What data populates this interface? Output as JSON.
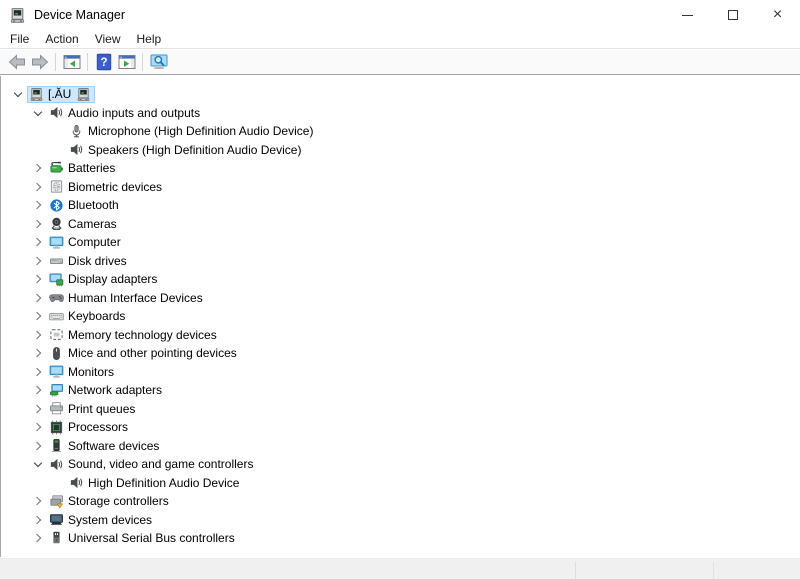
{
  "window": {
    "title": "Device Manager",
    "app_icon": "device-manager-icon",
    "controls": {
      "minimize": "minimize",
      "maximize": "maximize",
      "close_glyph": "×"
    }
  },
  "menubar": {
    "items": [
      {
        "label": "File"
      },
      {
        "label": "Action"
      },
      {
        "label": "View"
      },
      {
        "label": "Help"
      }
    ]
  },
  "toolbar": {
    "items": [
      {
        "type": "button",
        "name": "back",
        "icon": "back-arrow-icon"
      },
      {
        "type": "button",
        "name": "forward",
        "icon": "forward-arrow-icon"
      },
      {
        "type": "separator"
      },
      {
        "type": "button",
        "name": "show-console-tree",
        "icon": "console-tree-icon"
      },
      {
        "type": "separator"
      },
      {
        "type": "button",
        "name": "help",
        "icon": "help-icon"
      },
      {
        "type": "button",
        "name": "show-action-pane",
        "icon": "action-pane-icon"
      },
      {
        "type": "separator"
      },
      {
        "type": "button",
        "name": "scan-hardware-changes",
        "icon": "scan-hardware-icon"
      }
    ]
  },
  "tree": {
    "items": [
      {
        "label": "[.ĂU",
        "icon": "computer-icon",
        "trailing_icon": "computer-icon",
        "level": 0,
        "state": "expanded",
        "selected": true
      },
      {
        "label": "Audio inputs and outputs",
        "icon": "speaker-icon",
        "level": 1,
        "state": "expanded"
      },
      {
        "label": "Microphone (High Definition Audio Device)",
        "icon": "microphone-icon",
        "level": 2,
        "state": "none"
      },
      {
        "label": "Speakers (High Definition Audio Device)",
        "icon": "speaker-icon",
        "level": 2,
        "state": "none"
      },
      {
        "label": "Batteries",
        "icon": "battery-icon",
        "level": 1,
        "state": "collapsed"
      },
      {
        "label": "Biometric devices",
        "icon": "fingerprint-icon",
        "level": 1,
        "state": "collapsed"
      },
      {
        "label": "Bluetooth",
        "icon": "bluetooth-icon",
        "level": 1,
        "state": "collapsed"
      },
      {
        "label": "Cameras",
        "icon": "camera-icon",
        "level": 1,
        "state": "collapsed"
      },
      {
        "label": "Computer",
        "icon": "monitor-icon",
        "level": 1,
        "state": "collapsed"
      },
      {
        "label": "Disk drives",
        "icon": "disk-drive-icon",
        "level": 1,
        "state": "collapsed"
      },
      {
        "label": "Display adapters",
        "icon": "display-adapter-icon",
        "level": 1,
        "state": "collapsed"
      },
      {
        "label": "Human Interface Devices",
        "icon": "gamepad-icon",
        "level": 1,
        "state": "collapsed"
      },
      {
        "label": "Keyboards",
        "icon": "keyboard-icon",
        "level": 1,
        "state": "collapsed"
      },
      {
        "label": "Memory technology devices",
        "icon": "memory-icon",
        "level": 1,
        "state": "collapsed"
      },
      {
        "label": "Mice and other pointing devices",
        "icon": "mouse-icon",
        "level": 1,
        "state": "collapsed"
      },
      {
        "label": "Monitors",
        "icon": "monitor-icon",
        "level": 1,
        "state": "collapsed"
      },
      {
        "label": "Network adapters",
        "icon": "network-adapter-icon",
        "level": 1,
        "state": "collapsed"
      },
      {
        "label": "Print queues",
        "icon": "printer-icon",
        "level": 1,
        "state": "collapsed"
      },
      {
        "label": "Processors",
        "icon": "processor-icon",
        "level": 1,
        "state": "collapsed"
      },
      {
        "label": "Software devices",
        "icon": "software-device-icon",
        "level": 1,
        "state": "collapsed"
      },
      {
        "label": "Sound, video and game controllers",
        "icon": "speaker-icon",
        "level": 1,
        "state": "expanded"
      },
      {
        "label": "High Definition Audio Device",
        "icon": "speaker-icon",
        "level": 2,
        "state": "none"
      },
      {
        "label": "Storage controllers",
        "icon": "storage-controller-icon",
        "level": 1,
        "state": "collapsed"
      },
      {
        "label": "System devices",
        "icon": "system-device-icon",
        "level": 1,
        "state": "collapsed"
      },
      {
        "label": "Universal Serial Bus controllers",
        "icon": "usb-icon",
        "level": 1,
        "state": "collapsed"
      }
    ]
  },
  "colors": {
    "selection_bg": "#cce8ff",
    "selection_border": "#99d1ff",
    "toolbar_border": "#a2a2a2",
    "bottom_strip_bg": "#f0f0f0",
    "bluetooth_blue": "#1878d2",
    "help_blue": "#3a5fcd",
    "green_accent": "#43a047"
  }
}
